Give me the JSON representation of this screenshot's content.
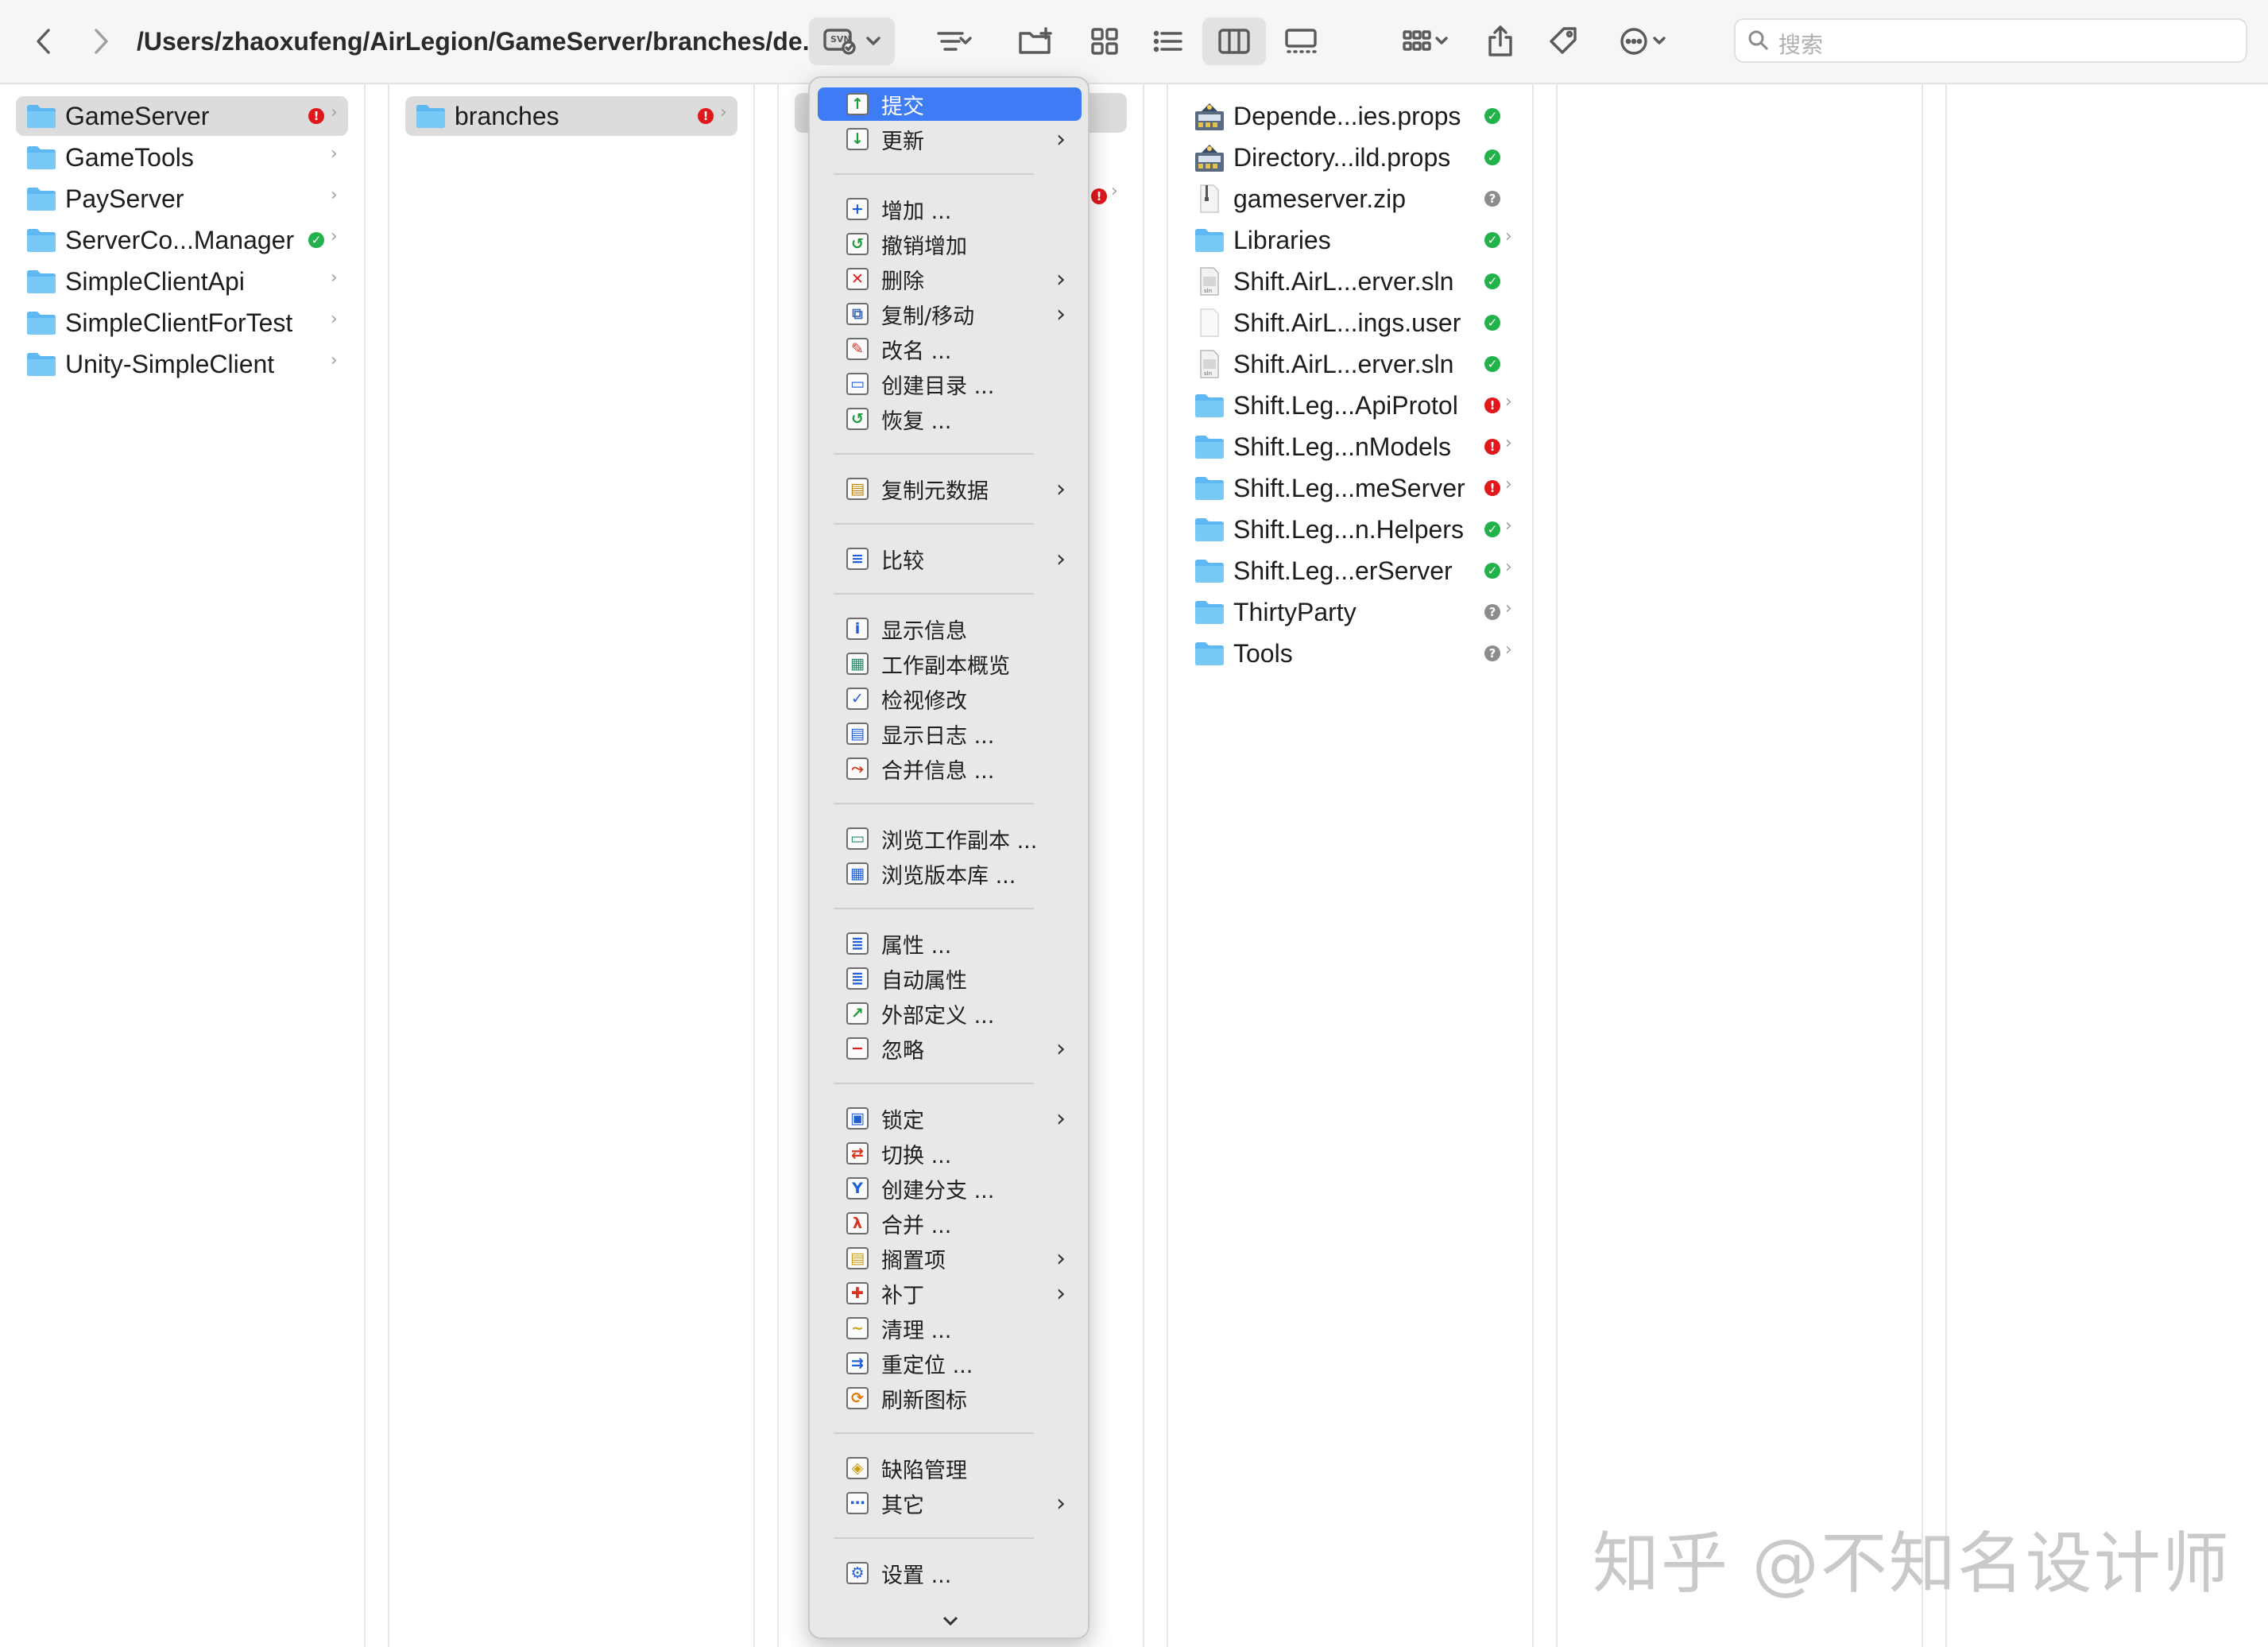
{
  "toolbar": {
    "path": "/Users/zhaoxufeng/AirLegion/GameServer/branches/de...",
    "svn_label": "SVN",
    "search_placeholder": "搜索"
  },
  "column1": [
    {
      "label": "GameServer",
      "status": "red",
      "selected": true
    },
    {
      "label": "GameTools",
      "status": "",
      "selected": false
    },
    {
      "label": "PayServer",
      "status": "",
      "selected": false
    },
    {
      "label": "ServerCo...Manager",
      "status": "green",
      "selected": false
    },
    {
      "label": "SimpleClientApi",
      "status": "",
      "selected": false
    },
    {
      "label": "SimpleClientForTest",
      "status": "",
      "selected": false
    },
    {
      "label": "Unity-SimpleClient",
      "status": "",
      "selected": false
    }
  ],
  "column2": [
    {
      "label": "branches",
      "status": "red",
      "selected": true
    }
  ],
  "column4": [
    {
      "label": "Depende...ies.props",
      "icon": "props",
      "status": "green"
    },
    {
      "label": "Directory...ild.props",
      "icon": "props",
      "status": "green"
    },
    {
      "label": "gameserver.zip",
      "icon": "zip",
      "status": "gray"
    },
    {
      "label": "Libraries",
      "icon": "folder",
      "status": "green"
    },
    {
      "label": "Shift.AirL...erver.sln",
      "icon": "sln",
      "status": "green"
    },
    {
      "label": "Shift.AirL...ings.user",
      "icon": "file",
      "status": "green"
    },
    {
      "label": "Shift.AirL...erver.sln",
      "icon": "sln",
      "status": "green"
    },
    {
      "label": "Shift.Leg...ApiProtol",
      "icon": "folder",
      "status": "red"
    },
    {
      "label": "Shift.Leg...nModels",
      "icon": "folder",
      "status": "red"
    },
    {
      "label": "Shift.Leg...meServer",
      "icon": "folder",
      "status": "red"
    },
    {
      "label": "Shift.Leg...n.Helpers",
      "icon": "folder",
      "status": "green"
    },
    {
      "label": "Shift.Leg...erServer",
      "icon": "folder",
      "status": "green"
    },
    {
      "label": "ThirtyParty",
      "icon": "folder",
      "status": "gray"
    },
    {
      "label": "Tools",
      "icon": "folder",
      "status": "gray"
    }
  ],
  "menu": [
    {
      "label": "提交",
      "icon": "commit-icon",
      "glyph": "↑",
      "color": "#1e9a3a",
      "sub": false,
      "highlight": true
    },
    {
      "label": "更新",
      "icon": "update-icon",
      "glyph": "↓",
      "color": "#1e9a3a",
      "sub": true
    },
    {
      "sep": true
    },
    {
      "label": "增加 ...",
      "icon": "add-icon",
      "glyph": "+",
      "color": "#1f5fd8",
      "sub": false
    },
    {
      "label": "撤销增加",
      "icon": "undo-add-icon",
      "glyph": "↺",
      "color": "#1e9a3a",
      "sub": false
    },
    {
      "label": "删除",
      "icon": "delete-icon",
      "glyph": "✕",
      "color": "#d81e1e",
      "sub": true
    },
    {
      "label": "复制/移动",
      "icon": "copy-move-icon",
      "glyph": "⧉",
      "color": "#4a6fb8",
      "sub": true
    },
    {
      "label": "改名 ...",
      "icon": "rename-icon",
      "glyph": "✎",
      "color": "#d8331e",
      "sub": false
    },
    {
      "label": "创建目录 ...",
      "icon": "create-folder-icon",
      "glyph": "▭",
      "color": "#1f5fd8",
      "sub": false
    },
    {
      "label": "恢复 ...",
      "icon": "revert-icon",
      "glyph": "↺",
      "color": "#1e9a3a",
      "sub": false
    },
    {
      "sep": true
    },
    {
      "label": "复制元数据",
      "icon": "copy-metadata-icon",
      "glyph": "▤",
      "color": "#b8860b",
      "sub": true
    },
    {
      "sep": true
    },
    {
      "label": "比较",
      "icon": "diff-icon",
      "glyph": "≡",
      "color": "#1f5fd8",
      "sub": true
    },
    {
      "sep": true
    },
    {
      "label": "显示信息",
      "icon": "info-icon",
      "glyph": "i",
      "color": "#1f5fd8",
      "sub": false
    },
    {
      "label": "工作副本概览",
      "icon": "overview-icon",
      "glyph": "▦",
      "color": "#2a8a6a",
      "sub": false
    },
    {
      "label": "检视修改",
      "icon": "check-mods-icon",
      "glyph": "✓",
      "color": "#1f5fd8",
      "sub": false
    },
    {
      "label": "显示日志 ...",
      "icon": "log-icon",
      "glyph": "▤",
      "color": "#1f5fd8",
      "sub": false
    },
    {
      "label": "合并信息 ...",
      "icon": "merge-info-icon",
      "glyph": "⤳",
      "color": "#d8331e",
      "sub": false
    },
    {
      "sep": true
    },
    {
      "label": "浏览工作副本 ...",
      "icon": "browse-wc-icon",
      "glyph": "▭",
      "color": "#2a8a6a",
      "sub": false
    },
    {
      "label": "浏览版本库 ...",
      "icon": "browse-repo-icon",
      "glyph": "▦",
      "color": "#1f5fd8",
      "sub": false
    },
    {
      "sep": true
    },
    {
      "label": "属性 ...",
      "icon": "properties-icon",
      "glyph": "≣",
      "color": "#1f5fd8",
      "sub": false
    },
    {
      "label": "自动属性",
      "icon": "auto-props-icon",
      "glyph": "≣",
      "color": "#1f5fd8",
      "sub": false
    },
    {
      "label": "外部定义 ...",
      "icon": "externals-icon",
      "glyph": "↗",
      "color": "#1e9a3a",
      "sub": false
    },
    {
      "label": "忽略",
      "icon": "ignore-icon",
      "glyph": "−",
      "color": "#d81e1e",
      "sub": true
    },
    {
      "sep": true
    },
    {
      "label": "锁定",
      "icon": "lock-icon",
      "glyph": "▣",
      "color": "#1f5fd8",
      "sub": true
    },
    {
      "label": "切换 ...",
      "icon": "switch-icon",
      "glyph": "⇄",
      "color": "#d8331e",
      "sub": false
    },
    {
      "label": "创建分支 ...",
      "icon": "branch-icon",
      "glyph": "Y",
      "color": "#1f5fd8",
      "sub": false
    },
    {
      "label": "合并 ...",
      "icon": "merge-icon",
      "glyph": "λ",
      "color": "#d8331e",
      "sub": false
    },
    {
      "label": "搁置项",
      "icon": "shelve-icon",
      "glyph": "▤",
      "color": "#c8a018",
      "sub": true
    },
    {
      "label": "补丁",
      "icon": "patch-icon",
      "glyph": "✚",
      "color": "#d8331e",
      "sub": true
    },
    {
      "label": "清理 ...",
      "icon": "cleanup-icon",
      "glyph": "~",
      "color": "#c8a018",
      "sub": false
    },
    {
      "label": "重定位 ...",
      "icon": "relocate-icon",
      "glyph": "⇉",
      "color": "#1f5fd8",
      "sub": false
    },
    {
      "label": "刷新图标",
      "icon": "refresh-icons-icon",
      "glyph": "⟳",
      "color": "#e07a10",
      "sub": false
    },
    {
      "sep": true
    },
    {
      "label": "缺陷管理",
      "icon": "bug-tracker-icon",
      "glyph": "◈",
      "color": "#c8a018",
      "sub": false
    },
    {
      "label": "其它",
      "icon": "other-icon",
      "glyph": "⋯",
      "color": "#1f5fd8",
      "sub": true
    },
    {
      "sep": true
    },
    {
      "label": "设置 ...",
      "icon": "settings-icon",
      "glyph": "⚙",
      "color": "#1f5fd8",
      "sub": false
    }
  ],
  "watermark": "知乎 @不知名设计师"
}
